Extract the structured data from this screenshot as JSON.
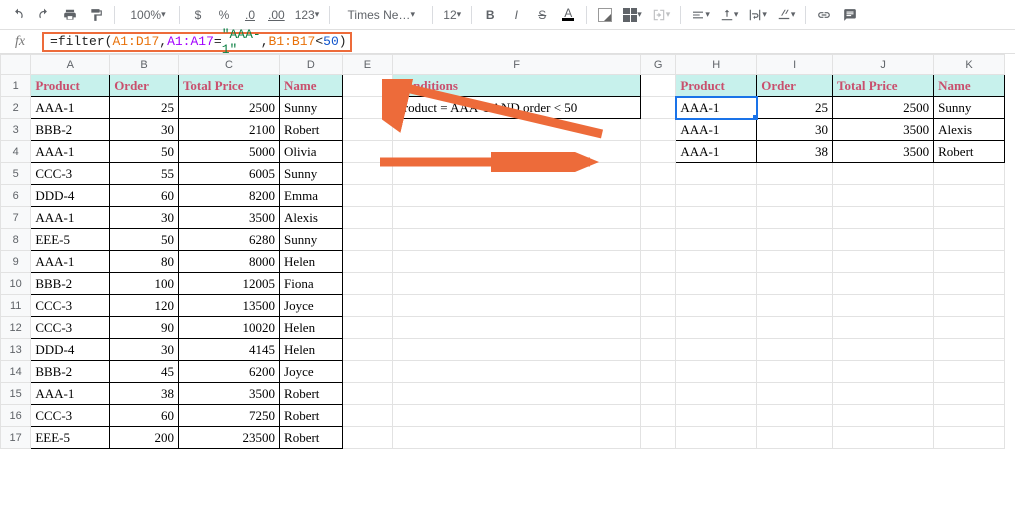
{
  "toolbar": {
    "zoom": "100%",
    "font_name": "Times Ne…",
    "font_size": "12",
    "bold": "B",
    "italic": "I",
    "strike": "S",
    "text_color": "A",
    "number_fmt": "123",
    "currency": "$",
    "percent": "%",
    "dec_less": ".0",
    "dec_more": ".00"
  },
  "formula": {
    "fx": "fx",
    "eq": "=",
    "func": "filter",
    "open": "(",
    "r1": "A1:D17",
    "c1": ",",
    "r2": "A1:A17",
    "eq2": "=",
    "str": "\"AAA-1\"",
    "c2": ",",
    "r3": "B1:B17",
    "lt": "<",
    "num": "50",
    "close": ")"
  },
  "cols": [
    "A",
    "B",
    "C",
    "D",
    "E",
    "F",
    "G",
    "H",
    "I",
    "J",
    "K"
  ],
  "rows": [
    "1",
    "2",
    "3",
    "4",
    "5",
    "6",
    "7",
    "8",
    "9",
    "10",
    "11",
    "12",
    "13",
    "14",
    "15",
    "16",
    "17"
  ],
  "headers": {
    "product": "Product",
    "order": "Order",
    "total_price": "Total Price",
    "name": "Name",
    "conditions": "Conditions"
  },
  "condition_text": "product = AAA-1 AND order < 50",
  "table1": [
    {
      "p": "AAA-1",
      "o": "25",
      "t": "2500",
      "n": "Sunny"
    },
    {
      "p": "BBB-2",
      "o": "30",
      "t": "2100",
      "n": "Robert"
    },
    {
      "p": "AAA-1",
      "o": "50",
      "t": "5000",
      "n": "Olivia"
    },
    {
      "p": "CCC-3",
      "o": "55",
      "t": "6005",
      "n": "Sunny"
    },
    {
      "p": "DDD-4",
      "o": "60",
      "t": "8200",
      "n": "Emma"
    },
    {
      "p": "AAA-1",
      "o": "30",
      "t": "3500",
      "n": "Alexis"
    },
    {
      "p": "EEE-5",
      "o": "50",
      "t": "6280",
      "n": "Sunny"
    },
    {
      "p": "AAA-1",
      "o": "80",
      "t": "8000",
      "n": "Helen"
    },
    {
      "p": "BBB-2",
      "o": "100",
      "t": "12005",
      "n": "Fiona"
    },
    {
      "p": "CCC-3",
      "o": "120",
      "t": "13500",
      "n": "Joyce"
    },
    {
      "p": "CCC-3",
      "o": "90",
      "t": "10020",
      "n": "Helen"
    },
    {
      "p": "DDD-4",
      "o": "30",
      "t": "4145",
      "n": "Helen"
    },
    {
      "p": "BBB-2",
      "o": "45",
      "t": "6200",
      "n": "Joyce"
    },
    {
      "p": "AAA-1",
      "o": "38",
      "t": "3500",
      "n": "Robert"
    },
    {
      "p": "CCC-3",
      "o": "60",
      "t": "7250",
      "n": "Robert"
    },
    {
      "p": "EEE-5",
      "o": "200",
      "t": "23500",
      "n": "Robert"
    }
  ],
  "table2": [
    {
      "p": "AAA-1",
      "o": "25",
      "t": "2500",
      "n": "Sunny"
    },
    {
      "p": "AAA-1",
      "o": "30",
      "t": "3500",
      "n": "Alexis"
    },
    {
      "p": "AAA-1",
      "o": "38",
      "t": "3500",
      "n": "Robert"
    }
  ]
}
